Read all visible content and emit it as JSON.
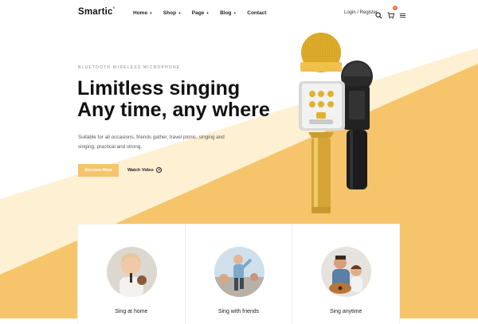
{
  "header": {
    "logo": "Smartic",
    "logo_mark": "°",
    "nav": [
      {
        "label": "Home",
        "caret": "+"
      },
      {
        "label": "Shop",
        "caret": "+"
      },
      {
        "label": "Page",
        "caret": "+"
      },
      {
        "label": "Blog",
        "caret": "+"
      },
      {
        "label": "Contact",
        "caret": ""
      }
    ],
    "login": "Login / Register",
    "icons": [
      "search-icon",
      "cart-icon",
      "menu-icon"
    ],
    "cart_count": "0"
  },
  "hero": {
    "eyebrow": "BLUETOOTH WIRELESS MICROPHONE",
    "title_line1": "Limitless singing",
    "title_line2": "Any time, any where",
    "description": "Suitable for all occasions, friends gather, travel picnic, singing and singing, practical and strong.",
    "primary_button": "Discover More",
    "watch_label": "Watch Video"
  },
  "cards": [
    {
      "label": "Sing at home"
    },
    {
      "label": "Sing with friends"
    },
    {
      "label": "Sing anytime"
    }
  ],
  "colors": {
    "accent": "#f6c46a",
    "accent_light": "#fde3ad",
    "text": "#111111",
    "badge": "#f06b3a"
  }
}
